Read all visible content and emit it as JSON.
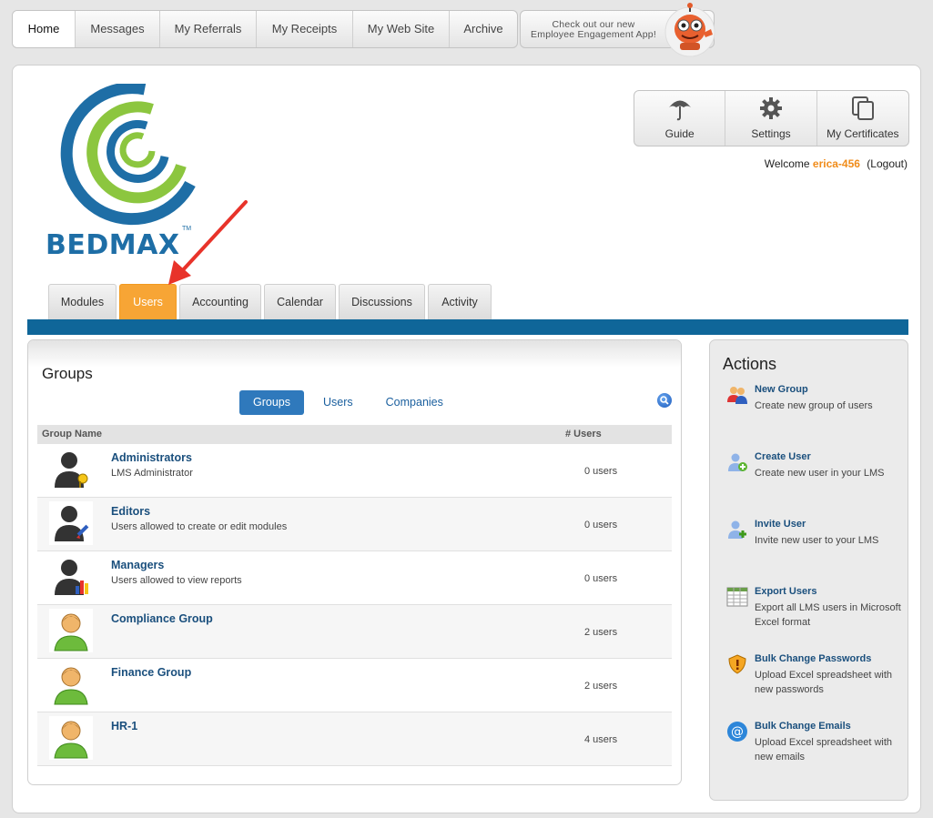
{
  "topnav": {
    "items": [
      {
        "label": "Home",
        "active": true
      },
      {
        "label": "Messages"
      },
      {
        "label": "My Referrals"
      },
      {
        "label": "My Receipts"
      },
      {
        "label": "My Web Site"
      },
      {
        "label": "Archive"
      }
    ],
    "promo_line1": "Check out our new",
    "promo_line2": "Employee Engagement App!"
  },
  "brand": {
    "name": "BEDMAX",
    "tm": "TM",
    "primary_color": "#1e6ea6",
    "secondary_color": "#8cc63f"
  },
  "toolbox": {
    "guide": "Guide",
    "settings": "Settings",
    "certificates": "My Certificates"
  },
  "welcome": {
    "prefix": "Welcome",
    "username": "erica-456",
    "logout": "(Logout)"
  },
  "tabs": [
    {
      "label": "Modules"
    },
    {
      "label": "Users",
      "active": true
    },
    {
      "label": "Accounting"
    },
    {
      "label": "Calendar"
    },
    {
      "label": "Discussions"
    },
    {
      "label": "Activity"
    }
  ],
  "groups": {
    "title": "Groups",
    "subtabs": [
      "Groups",
      "Users",
      "Companies"
    ],
    "columns": {
      "name": "Group Name",
      "users": "# Users"
    },
    "rows": [
      {
        "name": "Administrators",
        "desc": "LMS Administrator",
        "count": "0 users"
      },
      {
        "name": "Editors",
        "desc": "Users allowed to create or edit modules",
        "count": "0 users"
      },
      {
        "name": "Managers",
        "desc": "Users allowed to view reports",
        "count": "0 users"
      },
      {
        "name": "Compliance Group",
        "desc": "",
        "count": "2 users"
      },
      {
        "name": "Finance Group",
        "desc": "",
        "count": "2 users"
      },
      {
        "name": "HR-1",
        "desc": "",
        "count": "4 users"
      }
    ]
  },
  "actions": {
    "title": "Actions",
    "items": [
      {
        "name": "New Group",
        "desc": "Create new group of users",
        "icon": "new-group-icon"
      },
      {
        "name": "Create User",
        "desc": "Create new user in your LMS",
        "icon": "create-user-icon"
      },
      {
        "name": "Invite User",
        "desc": "Invite new user to your LMS",
        "icon": "invite-user-icon"
      },
      {
        "name": "Export Users",
        "desc": "Export all LMS users in Microsoft Excel format",
        "icon": "spreadsheet-icon"
      },
      {
        "name": "Bulk Change Passwords",
        "desc": "Upload Excel spreadsheet with new passwords",
        "icon": "shield-icon"
      },
      {
        "name": "Bulk Change Emails",
        "desc": "Upload Excel spreadsheet with new emails",
        "icon": "at-sign-icon"
      }
    ]
  },
  "colors": {
    "accent_orange": "#f7a535",
    "nav_blue": "#0f6699",
    "link_blue": "#1a4f7d",
    "annotation_red": "#e8332a"
  }
}
